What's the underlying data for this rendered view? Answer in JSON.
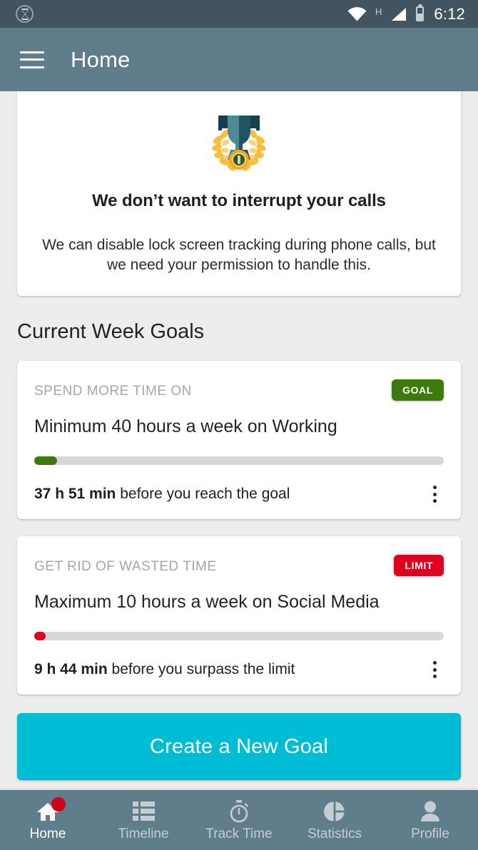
{
  "status_bar": {
    "left_icon": "hourglass-icon",
    "wifi_icon": "wifi-icon",
    "network_label": "H",
    "signal_icon": "signal-icon",
    "battery_icon": "battery-icon",
    "time": "6:12"
  },
  "app_bar": {
    "menu_icon": "hamburger-menu-icon",
    "title": "Home"
  },
  "permission_card": {
    "illustration": "trophy-medal-icon",
    "title": "We don’t want to interrupt your calls",
    "body": "We can disable lock screen tracking during phone calls, but we need your permission to handle this."
  },
  "section": {
    "title": "Current Week Goals"
  },
  "goals": [
    {
      "kicker": "SPEND MORE TIME ON",
      "badge": "GOAL",
      "badge_type": "goal",
      "badge_color": "#3d7a0c",
      "title": "Minimum 40 hours a week on Working",
      "progress_percent": 5.5,
      "progress_color": "#3d7a0c",
      "status_value": "37 h 51 min",
      "status_text": " before you reach the goal",
      "menu_icon": "kebab-menu-icon"
    },
    {
      "kicker": "GET RID OF WASTED TIME",
      "badge": "LIMIT",
      "badge_type": "limit",
      "badge_color": "#e00020",
      "title": "Maximum 10 hours a week on Social Media",
      "progress_percent": 2.8,
      "progress_color": "#e00020",
      "status_value": "9 h 44 min",
      "status_text": " before you surpass the limit",
      "menu_icon": "kebab-menu-icon"
    }
  ],
  "cta": {
    "label": "Create a New Goal",
    "color": "#00bcd4"
  },
  "bottom_nav": {
    "items": [
      {
        "label": "Home",
        "icon": "home-icon",
        "active": true,
        "badge": true
      },
      {
        "label": "Timeline",
        "icon": "list-icon",
        "active": false,
        "badge": false
      },
      {
        "label": "Track Time",
        "icon": "stopwatch-icon",
        "active": false,
        "badge": false
      },
      {
        "label": "Statistics",
        "icon": "pie-chart-icon",
        "active": false,
        "badge": false
      },
      {
        "label": "Profile",
        "icon": "person-icon",
        "active": false,
        "badge": false
      }
    ],
    "badge_color": "#d0021b"
  },
  "theme": {
    "status_bar_bg": "#415460",
    "app_bar_bg": "#607d8b",
    "page_bg": "#eceded",
    "card_bg": "#ffffff",
    "track_bg": "#d6d7d8"
  }
}
